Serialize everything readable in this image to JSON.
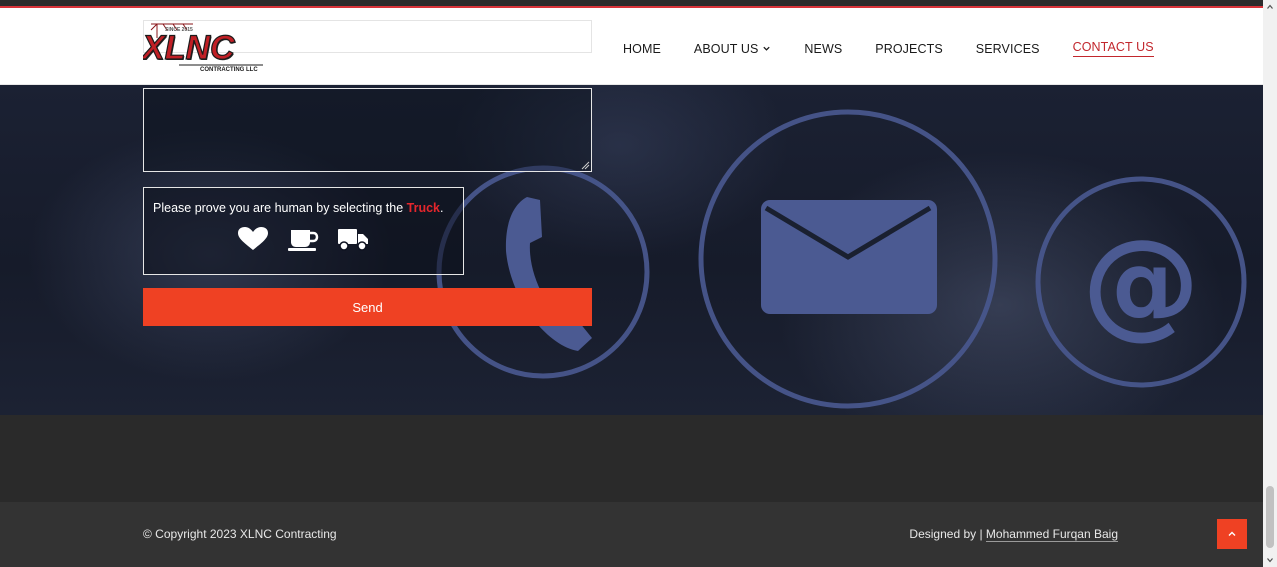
{
  "header": {
    "logo": {
      "wordmark": "XLNC",
      "tagline": "CONTRACTING LLC",
      "since": "SINCE 2015"
    },
    "nav": [
      {
        "label": "HOME"
      },
      {
        "label": "ABOUT US"
      },
      {
        "label": "NEWS"
      },
      {
        "label": "PROJECTS"
      },
      {
        "label": "SERVICES"
      },
      {
        "label": "CONTACT US"
      }
    ],
    "active_nav": "CONTACT US"
  },
  "contact_form": {
    "message_value": "",
    "captcha": {
      "prompt": "Please prove you are human by selecting the",
      "target": "Truck",
      "suffix": ".",
      "options": [
        "heart-icon",
        "coffee-cup-icon",
        "truck-icon"
      ]
    },
    "send_label": "Send"
  },
  "hero_icons": [
    "phone-icon",
    "envelope-icon",
    "at-sign-icon"
  ],
  "footer": {
    "copyright": "© Copyright 2023 XLNC Contracting",
    "designed_by_prefix": "Designed by | ",
    "designer": "Mohammed Furqan Baig"
  },
  "colors": {
    "brand_red": "#c2272d",
    "button_orange": "#ef4123",
    "hero_icon_blue": "#48568c",
    "footer_dark": "#333333"
  }
}
